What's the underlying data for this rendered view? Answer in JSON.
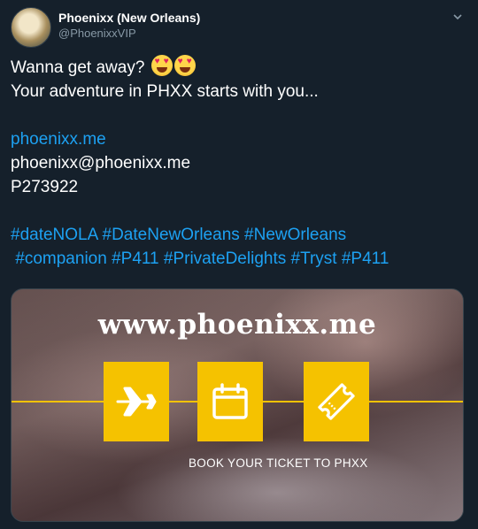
{
  "tweet": {
    "display_name": "Phoenixx (New Orleans)",
    "handle": "@PhoenixxVIP",
    "line1": "Wanna get away?",
    "line2": "Your adventure in PHXX starts with you...",
    "link": "phoenixx.me",
    "email": "phoenixx@phoenixx.me",
    "code": "P273922",
    "hashtags_line1": "#dateNOLA #DateNewOrleans #NewOrleans",
    "hashtags_line2": " #companion #P411 #PrivateDelights #Tryst #P411"
  },
  "media": {
    "site_text": "www.phoenixx.me",
    "book_text": "BOOK YOUR TICKET TO PHXX",
    "icons": [
      "airplane-icon",
      "calendar-icon",
      "ticket-icon"
    ],
    "accent_color": "#f5c200"
  },
  "colors": {
    "background": "#15202b",
    "link": "#1da1f2",
    "secondary": "#8899a6"
  }
}
